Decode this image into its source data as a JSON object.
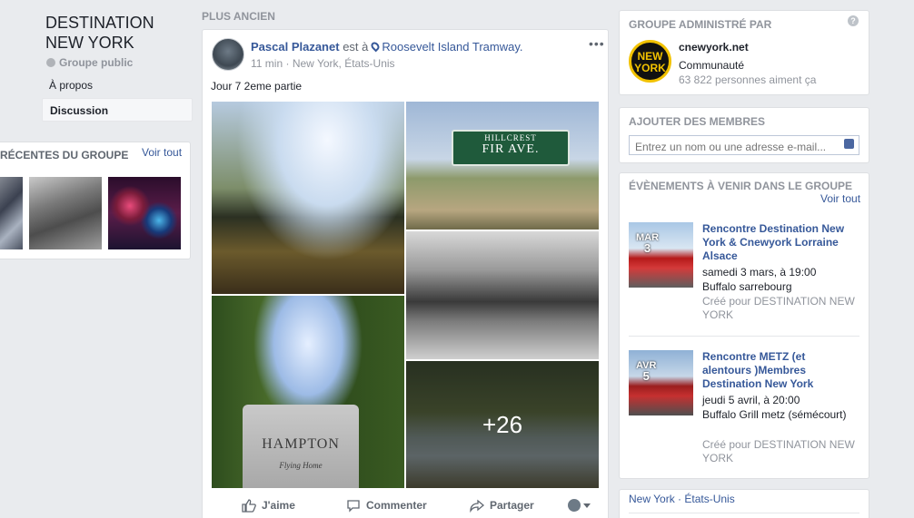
{
  "group": {
    "name": "DESTINATION NEW YORK",
    "privacy": "Groupe public",
    "nav": {
      "about": "À propos",
      "discussion": "Discussion"
    }
  },
  "recent": {
    "title": "RÉCENTES DU GROUPE",
    "see_all": "Voir tout"
  },
  "feed": {
    "section_label": "PLUS ANCIEN",
    "post": {
      "author": "Pascal Plazanet",
      "at": "est à",
      "place": "Roosevelt Island Tramway.",
      "time": "11 min",
      "location": "New York, États-Unis",
      "text": "Jour 7 2eme partie",
      "sign_top": "HILLCREST",
      "sign_bottom": "FIR AVE.",
      "stone_name": "HAMPTON",
      "stone_sub": "Flying Home",
      "more_photos": "+26",
      "actions": {
        "like": "J'aime",
        "comment": "Commenter",
        "share": "Partager"
      }
    }
  },
  "admin": {
    "title": "GROUPE ADMINISTRÉ PAR",
    "logo_line1": "NEW",
    "logo_line2": "YORK",
    "name": "cnewyork.net",
    "type": "Communauté",
    "likes": "63 822 personnes aiment ça"
  },
  "add_members": {
    "title": "AJOUTER DES MEMBRES",
    "placeholder": "Entrez un nom ou une adresse e-mail..."
  },
  "events": {
    "title": "ÉVÈNEMENTS À VENIR DANS LE GROUPE",
    "see_all": "Voir tout",
    "items": [
      {
        "month": "MAR",
        "day": "3",
        "name": "Rencontre Destination New York & Cnewyork Lorraine Alsace",
        "when": "samedi 3 mars, à 19:00",
        "where": "Buffalo sarrebourg",
        "created_for": "Créé pour DESTINATION NEW YORK"
      },
      {
        "month": "AVR",
        "day": "5",
        "name": "Rencontre METZ (et alentours )Membres Destination New York",
        "when": "jeudi 5 avril, à 20:00",
        "where": "Buffalo Grill metz (sémécourt)",
        "created_for": "Créé pour DESTINATION NEW YORK"
      }
    ]
  },
  "location_footer": "New York · États-Unis"
}
